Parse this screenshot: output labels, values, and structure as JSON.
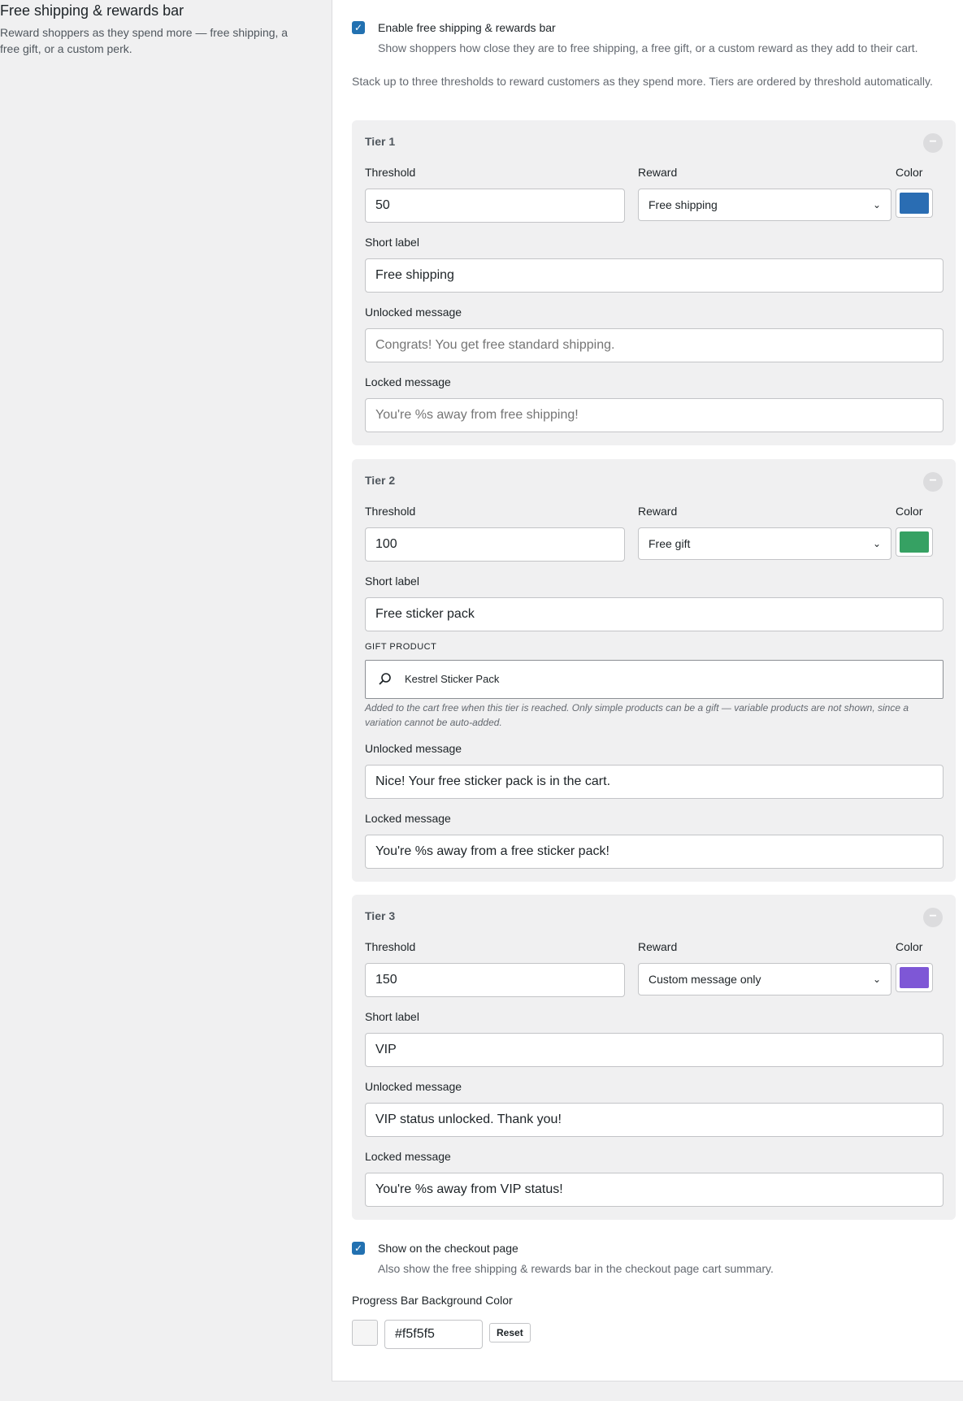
{
  "section": {
    "title": "Free shipping & rewards bar",
    "description": "Reward shoppers as they spend more — free shipping, a free gift, or a custom perk."
  },
  "enable": {
    "label": "Enable free shipping & rewards bar",
    "description": "Show shoppers how close they are to free shipping, a free gift, or a custom reward as they add to their cart.",
    "checked": true
  },
  "intro": "Stack up to three thresholds to reward customers as they spend more. Tiers are ordered by threshold automatically.",
  "labels": {
    "threshold": "Threshold",
    "reward": "Reward",
    "color": "Color",
    "short_label": "Short label",
    "unlocked": "Unlocked message",
    "locked": "Locked message",
    "remove": "−"
  },
  "tiers": [
    {
      "title": "Tier 1",
      "threshold": "50",
      "reward": "Free shipping",
      "color": "#2a6db3",
      "short_label": "Free shipping",
      "unlocked_placeholder": "Congrats! You get free standard shipping.",
      "locked_placeholder": "You're %s away from free shipping!"
    },
    {
      "title": "Tier 2",
      "threshold": "100",
      "reward": "Free gift",
      "color": "#36a163",
      "short_label": "Free sticker pack",
      "gift_label": "Gift product",
      "gift_value": "Kestrel Sticker Pack",
      "gift_help": "Added to the cart free when this tier is reached. Only simple products can be a gift — variable products are not shown, since a variation cannot be auto-added.",
      "unlocked": "Nice! Your free sticker pack is in the cart.",
      "locked": "You're %s away from a free sticker pack!"
    },
    {
      "title": "Tier 3",
      "threshold": "150",
      "reward": "Custom message only",
      "color": "#7e57d6",
      "short_label": "VIP",
      "unlocked": "VIP status unlocked. Thank you!",
      "locked": "You're %s away from VIP status!"
    }
  ],
  "checkout": {
    "label": "Show on the checkout page",
    "description": "Also show the free shipping & rewards bar in the checkout page cart summary.",
    "checked": true
  },
  "progress_bg": {
    "title": "Progress Bar Background Color",
    "value": "#f5f5f5",
    "text": "#f5f5f5",
    "reset": "Reset"
  }
}
